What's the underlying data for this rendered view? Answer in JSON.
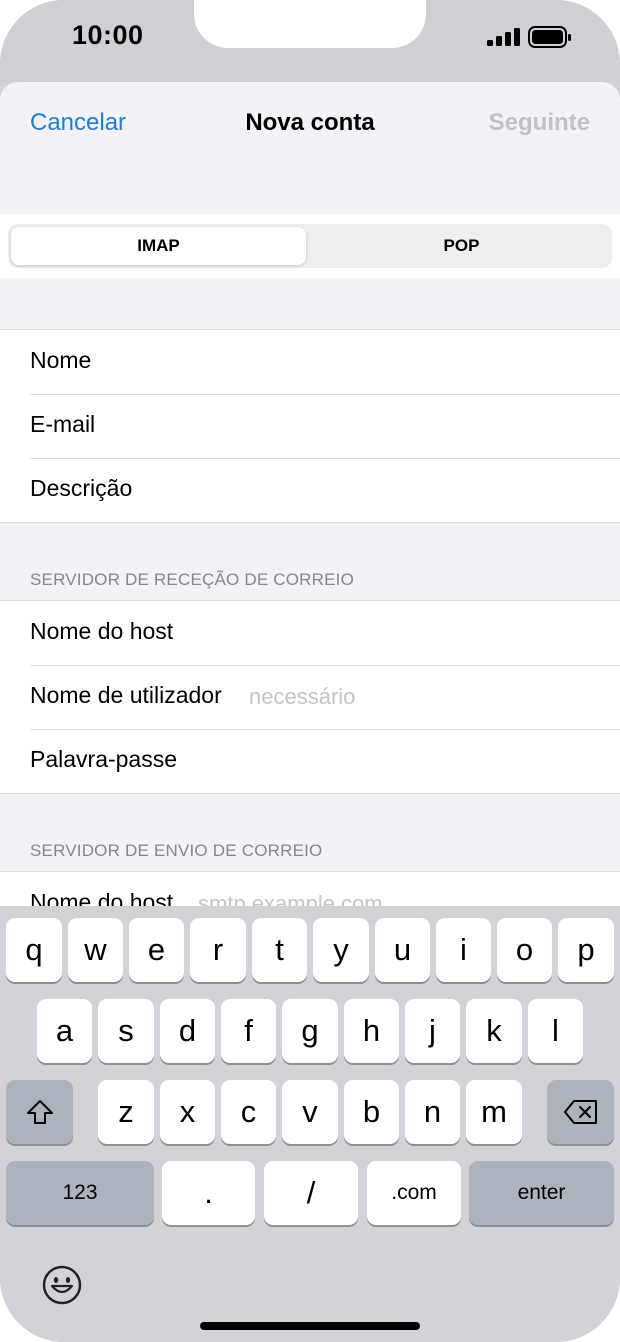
{
  "status_bar": {
    "time": "10:00"
  },
  "nav": {
    "cancel": "Cancelar",
    "title": "Nova conta",
    "next": "Seguinte"
  },
  "segment": {
    "options": [
      "IMAP",
      "POP"
    ],
    "selected": "IMAP"
  },
  "account_fields": [
    {
      "label": "Nome",
      "placeholder": ""
    },
    {
      "label": "E-mail",
      "placeholder": ""
    },
    {
      "label": "Descrição",
      "placeholder": ""
    }
  ],
  "incoming": {
    "header": "SERVIDOR DE RECEÇÃO DE CORREIO",
    "fields": [
      {
        "label": "Nome do host",
        "placeholder": ""
      },
      {
        "label": "Nome de utilizador",
        "placeholder": "necessário"
      },
      {
        "label": "Palavra-passe",
        "placeholder": ""
      }
    ]
  },
  "outgoing": {
    "header": "SERVIDOR DE ENVIO DE CORREIO",
    "fields": [
      {
        "label": "Nome do host",
        "placeholder": "smtp.example.com"
      }
    ]
  },
  "keyboard": {
    "row1": [
      "q",
      "w",
      "e",
      "r",
      "t",
      "y",
      "u",
      "i",
      "o",
      "p"
    ],
    "row2": [
      "a",
      "s",
      "d",
      "f",
      "g",
      "h",
      "j",
      "k",
      "l"
    ],
    "row3": [
      "z",
      "x",
      "c",
      "v",
      "b",
      "n",
      "m"
    ],
    "numbers_key": "123",
    "period_key": ".",
    "slash_key": "/",
    "dotcom_key": ".com",
    "enter_key": "enter",
    "shift_icon": "shift-icon",
    "delete_icon": "backspace-icon",
    "emoji_icon": "emoji-icon"
  },
  "colors": {
    "accent": "#1a7fd8",
    "disabled": "#c1c1c6",
    "placeholder": "#c4c4c8"
  }
}
